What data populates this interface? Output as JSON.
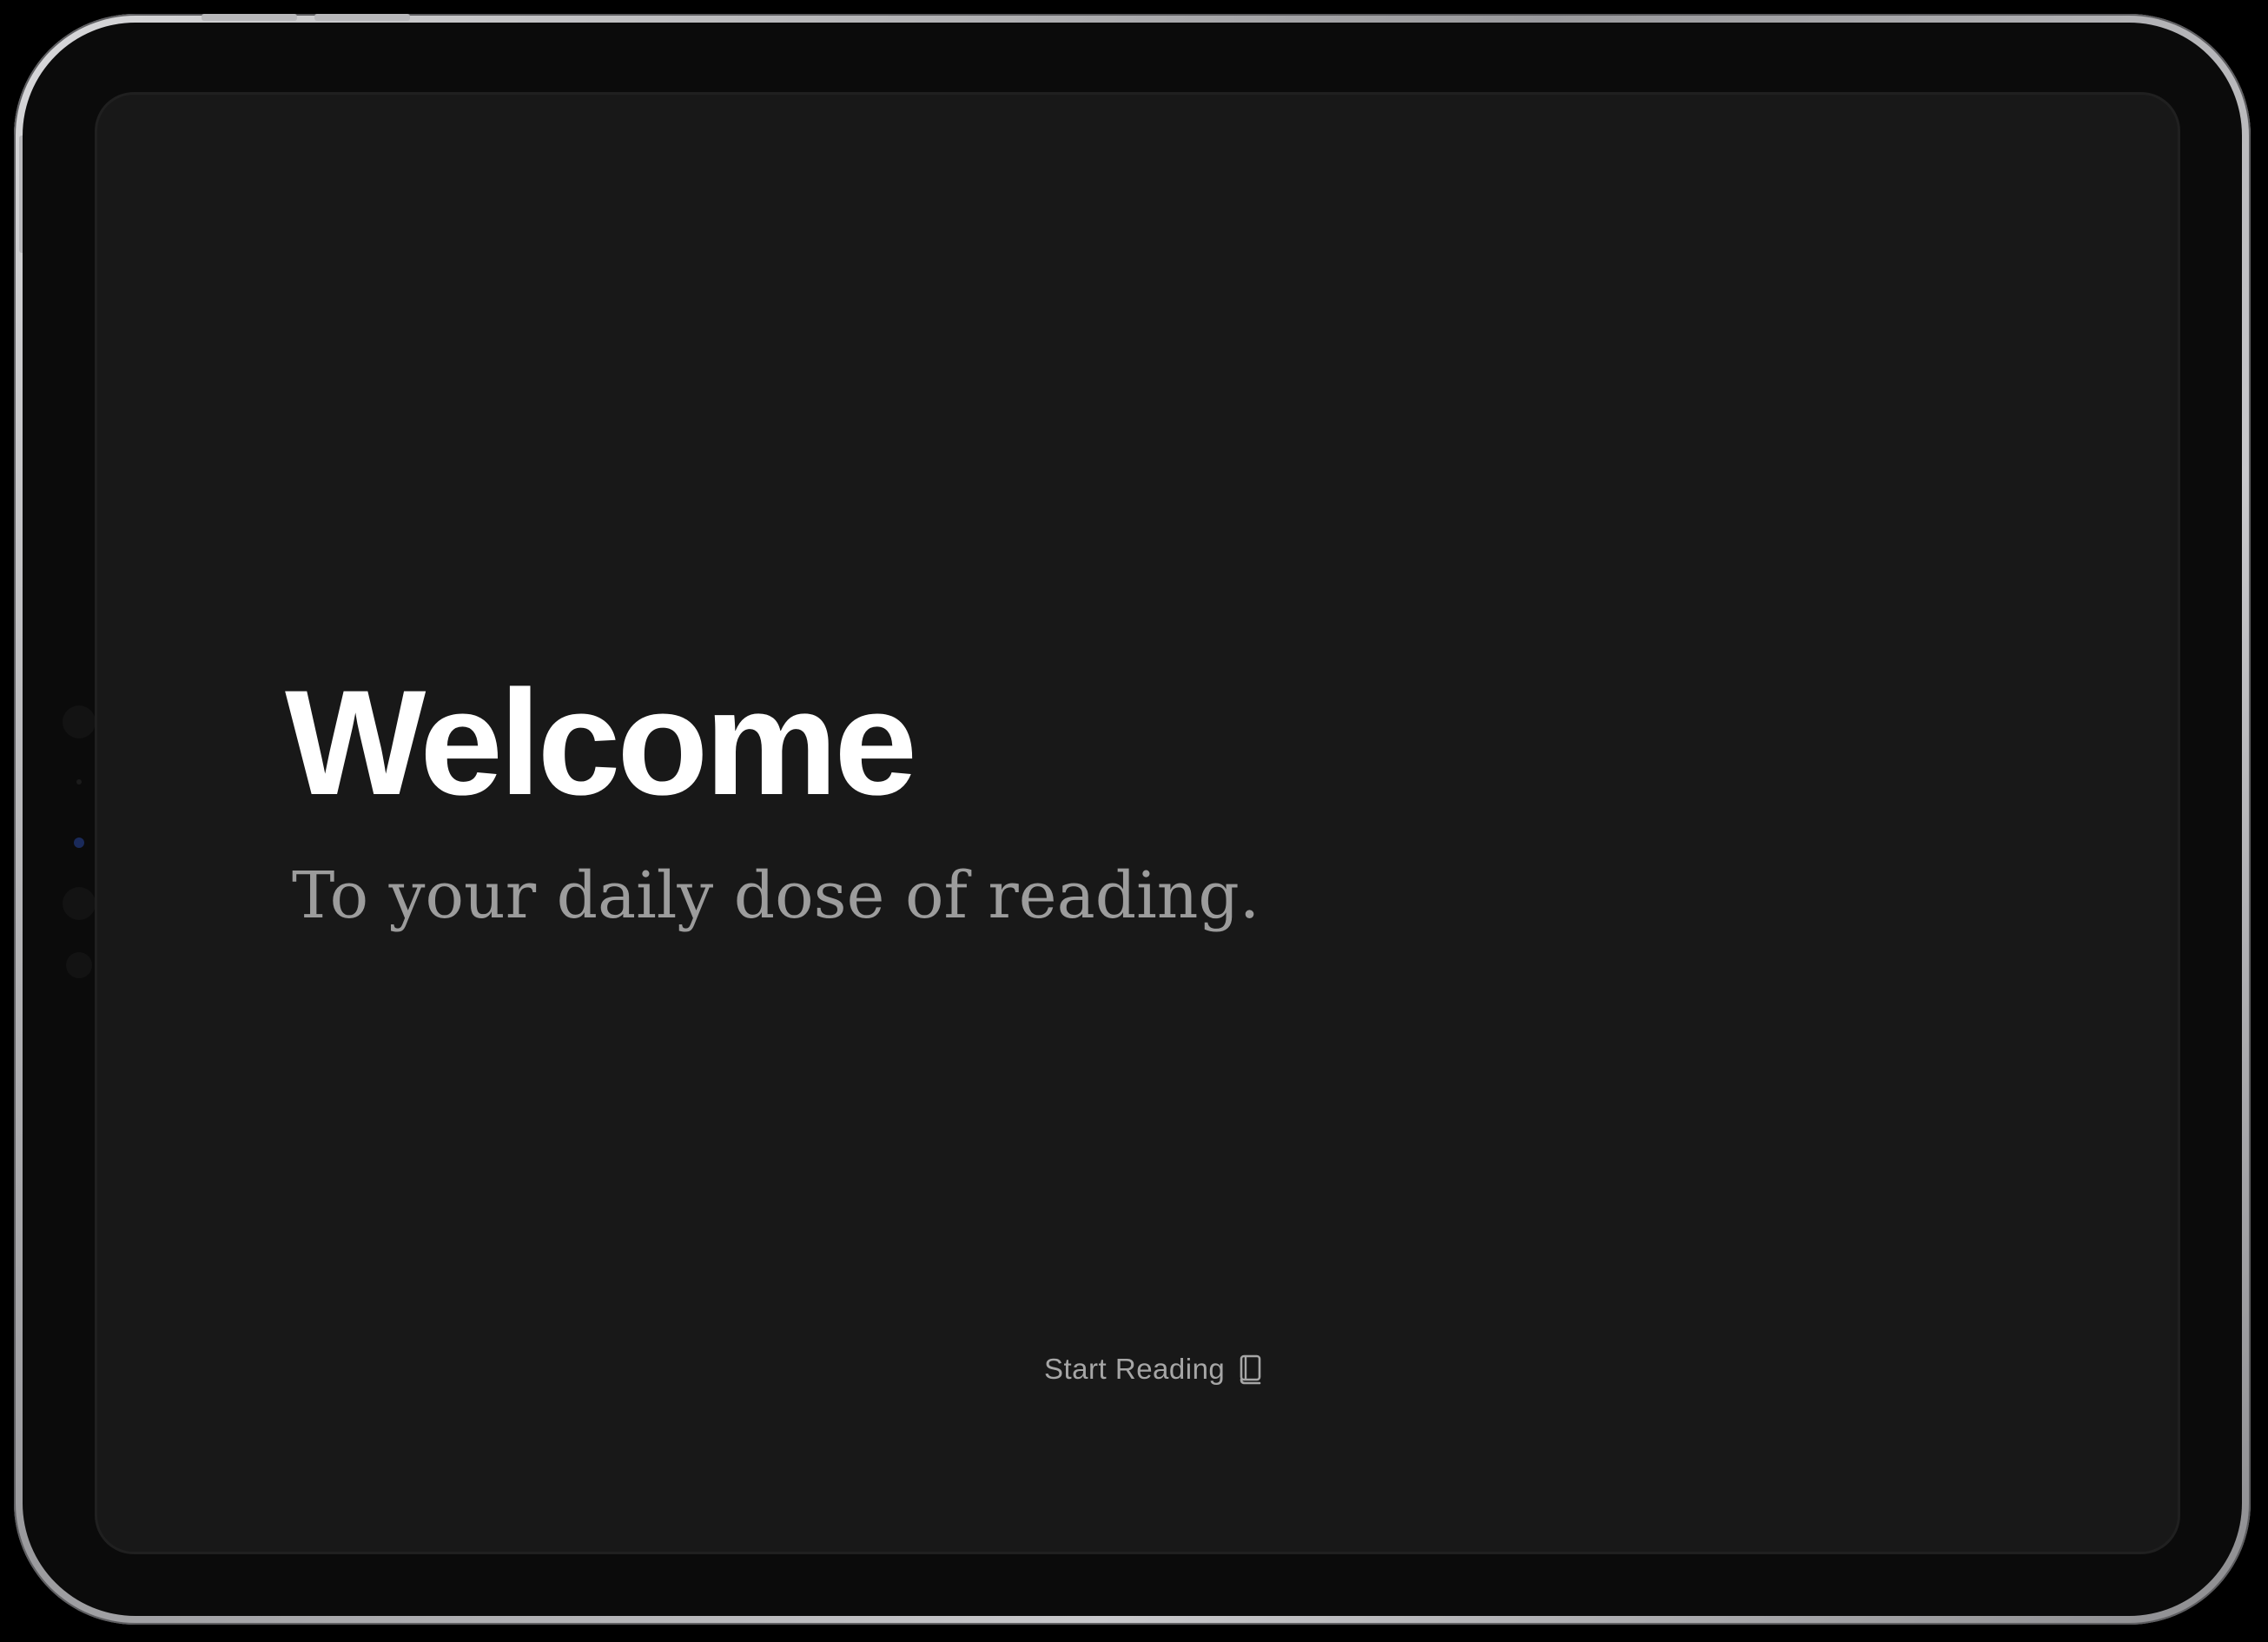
{
  "welcome": {
    "title": "Welcome",
    "subtitle": "To your daily dose of reading."
  },
  "action": {
    "start_label": "Start Reading",
    "icon": "book-icon"
  },
  "colors": {
    "screen_background": "#181818",
    "title": "#ffffff",
    "subtitle": "#9c9c9c",
    "button_text": "#a6a6a6"
  }
}
